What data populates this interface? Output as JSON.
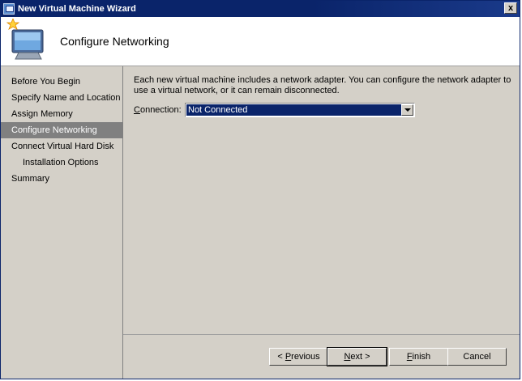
{
  "window": {
    "title": "New Virtual Machine Wizard",
    "close_glyph": "x"
  },
  "header": {
    "title": "Configure Networking",
    "icon": "new-vm-wizard-icon"
  },
  "nav": {
    "items": [
      {
        "label": "Before You Begin",
        "selected": false,
        "sub": false
      },
      {
        "label": "Specify Name and Location",
        "selected": false,
        "sub": false
      },
      {
        "label": "Assign Memory",
        "selected": false,
        "sub": false
      },
      {
        "label": "Configure Networking",
        "selected": true,
        "sub": false
      },
      {
        "label": "Connect Virtual Hard Disk",
        "selected": false,
        "sub": false
      },
      {
        "label": "Installation Options",
        "selected": false,
        "sub": true
      },
      {
        "label": "Summary",
        "selected": false,
        "sub": false
      }
    ]
  },
  "main": {
    "description": "Each new virtual machine includes a network adapter. You can configure the network adapter to use a virtual network, or it can remain disconnected.",
    "connection_label_underlined": "C",
    "connection_label_rest": "onnection:",
    "connection_value": "Not Connected"
  },
  "buttons": {
    "previous_prefix": "< ",
    "previous_u": "P",
    "previous_rest": "revious",
    "next_u": "N",
    "next_rest": "ext >",
    "finish_u": "F",
    "finish_rest": "inish",
    "cancel": "Cancel"
  },
  "colors": {
    "titlebar": "#0a246a",
    "selection": "#0a246a",
    "nav_selected": "#808080",
    "dialog_bg": "#d4d0c8"
  }
}
